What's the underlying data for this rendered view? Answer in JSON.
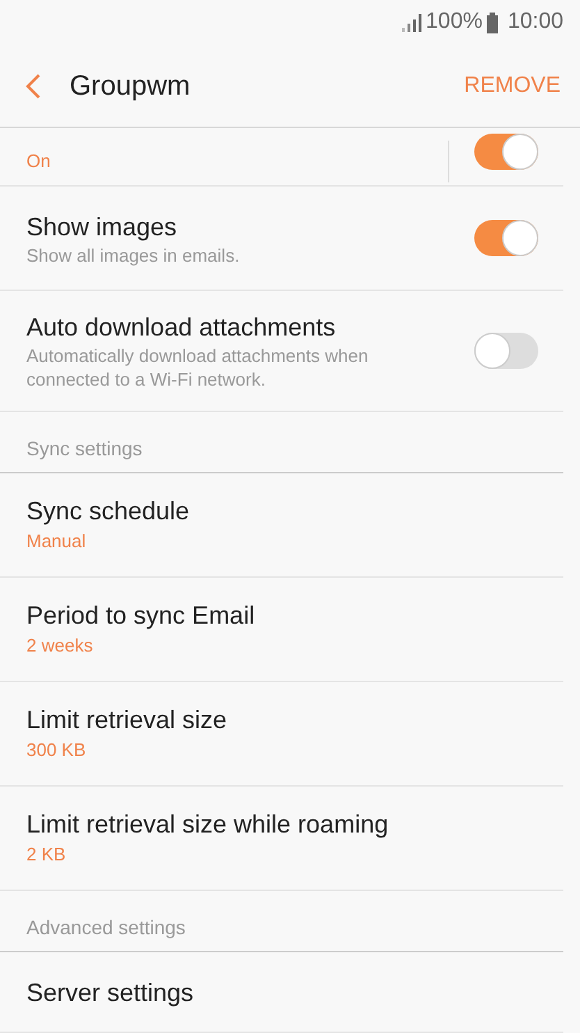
{
  "status_bar": {
    "battery": "100%",
    "time": "10:00"
  },
  "header": {
    "title": "Groupwm",
    "action": "REMOVE"
  },
  "items": [
    {
      "kind": "cutswitch",
      "subtitle": "On",
      "on": true
    },
    {
      "kind": "switch",
      "title": "Show images",
      "subtitle": "Show all images in emails.",
      "on": true
    },
    {
      "kind": "switch",
      "title": "Auto download attachments",
      "subtitle": "Automatically download attachments when connected to a Wi-Fi network.",
      "on": false
    },
    {
      "kind": "section",
      "title": "Sync settings"
    },
    {
      "kind": "value",
      "title": "Sync schedule",
      "value": "Manual"
    },
    {
      "kind": "value",
      "title": "Period to sync Email",
      "value": "2 weeks"
    },
    {
      "kind": "value",
      "title": "Limit retrieval size",
      "value": "300 KB"
    },
    {
      "kind": "value",
      "title": "Limit retrieval size while roaming",
      "value": "2 KB"
    },
    {
      "kind": "section",
      "title": "Advanced settings"
    },
    {
      "kind": "plain",
      "title": "Server settings"
    }
  ]
}
